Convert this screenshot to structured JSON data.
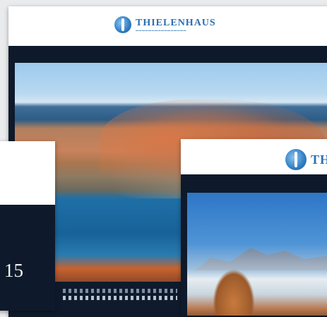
{
  "brand": {
    "name": "THIELENHAUS"
  },
  "left_calendar": {
    "year_fragment": "15"
  },
  "icons": {
    "logo": "globe-logo-icon"
  },
  "colors": {
    "band": "#0e1a2b",
    "brand": "#2a6fb3"
  }
}
